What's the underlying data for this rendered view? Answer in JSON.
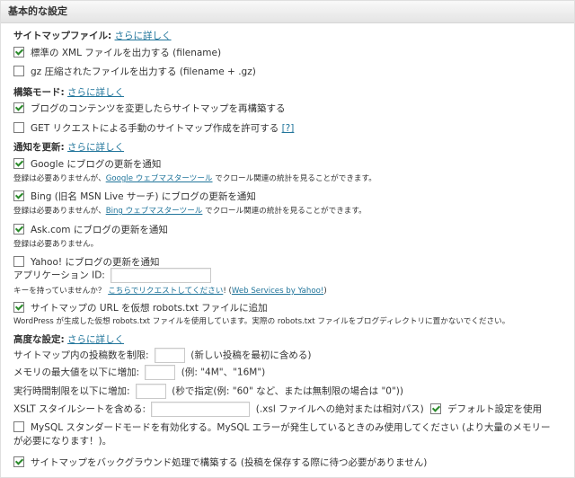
{
  "title": "基本的な設定",
  "sitemap_file": {
    "heading": "サイトマップファイル:",
    "more": "さらに詳しく",
    "xml": {
      "label": "標準の XML ファイルを出力する (filename)",
      "checked": true
    },
    "gz": {
      "label": "gz 圧縮されたファイルを出力する (filename + .gz)",
      "checked": false
    }
  },
  "build_mode": {
    "heading": "構築モード:",
    "more": "さらに詳しく",
    "rebuild": {
      "label": "ブログのコンテンツを変更したらサイトマップを再構築する",
      "checked": true
    },
    "get": {
      "label": "GET リクエストによる手動のサイトマップ作成を許可する",
      "checked": false,
      "help": "[?]"
    }
  },
  "notify": {
    "heading": "通知を更新:",
    "more": "さらに詳しく",
    "google": {
      "label": "Google にブログの更新を通知",
      "checked": true,
      "note_before": "登録は必要ありませんが、",
      "note_link": "Google ウェブマスターツール",
      "note_after": " でクロール関連の統計を見ることができます。"
    },
    "bing": {
      "label": "Bing (旧名 MSN Live サーチ) にブログの更新を通知",
      "checked": true,
      "note_before": "登録は必要ありませんが、",
      "note_link": "Bing ウェブマスターツール",
      "note_after": " でクロール関連の統計を見ることができます。"
    },
    "ask": {
      "label": "Ask.com にブログの更新を通知",
      "checked": true,
      "note": "登録は必要ありません。"
    },
    "yahoo": {
      "label": "Yahoo! にブログの更新を通知",
      "checked": false,
      "app_id_label": "アプリケーション ID:",
      "app_id_value": "",
      "key_text": "キーを持っていませんか？",
      "key_link": "こちらでリクエストしてください",
      "key_mid": "! (",
      "ws_link": "Web Services by Yahoo!",
      "key_end": ")"
    },
    "robots": {
      "label": "サイトマップの URL を仮想 robots.txt ファイルに追加",
      "checked": true,
      "note": "WordPress が生成した仮想 robots.txt ファイルを使用しています。実際の robots.txt ファイルをブログディレクトリに置かないでください。"
    }
  },
  "advanced": {
    "heading": "高度な設定:",
    "more": "さらに詳しく",
    "posts_limit": {
      "label": "サイトマップ内の投稿数を制限:",
      "value": "",
      "hint": "(新しい投稿を最初に含める)"
    },
    "memory": {
      "label": "メモリの最大値を以下に増加:",
      "value": "",
      "hint": "(例: \"4M\"、\"16M\")"
    },
    "exec_time": {
      "label": "実行時間制限を以下に増加:",
      "value": "",
      "hint": "(秒で指定(例: \"60\" など、または無制限の場合は \"0\"))"
    },
    "xslt": {
      "label": "XSLT スタイルシートを含める:",
      "value": "",
      "hint": "(.xsl ファイルへの絶対または相対パス)",
      "default_label": "デフォルト設定を使用",
      "default_checked": true
    },
    "mysql": {
      "label": "MySQL スタンダードモードを有効化する。MySQL エラーが発生しているときのみ使用してください (より大量のメモリーが必要になります！)。",
      "checked": false
    },
    "background": {
      "label": "サイトマップをバックグラウンド処理で構築する (投稿を保存する際に待つ必要がありません)",
      "checked": true
    }
  }
}
